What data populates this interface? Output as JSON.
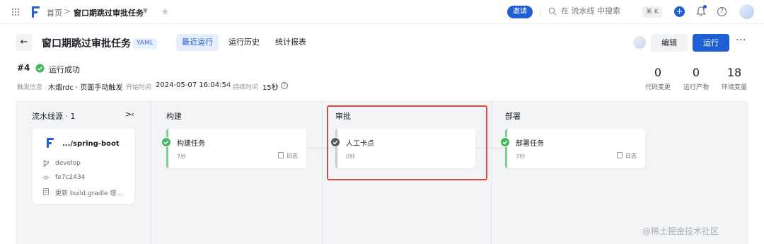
{
  "topbar": {
    "breadcrumb_home": "首页",
    "breadcrumb_sep": ">",
    "breadcrumb_current": "窗口期跳过审批任务",
    "invite_label": "邀请",
    "search_placeholder": "在 流水线 中搜索",
    "shortcut": "⌘ K"
  },
  "header": {
    "title": "窗口期跳过审批任务",
    "badge": "YAML",
    "tabs": [
      "最近运行",
      "运行历史",
      "统计报表"
    ],
    "edit_label": "编辑",
    "run_label": "运行",
    "more_label": "···"
  },
  "run": {
    "number": "#4",
    "status": "运行成功",
    "trigger_label": "触发信息",
    "trigger_value": "木烟rdc · 页面手动触发",
    "start_label": "开始时间",
    "start_value": "2024-05-07 16:04:54",
    "duration_label": "持续时间",
    "duration_value": "15秒",
    "stats": [
      {
        "value": "0",
        "label": "代码变更"
      },
      {
        "value": "0",
        "label": "运行产物"
      },
      {
        "value": "18",
        "label": "环境变量"
      }
    ]
  },
  "source": {
    "title": "流水线源 · 1",
    "collapse": ">‹",
    "repo": ".../spring-boot",
    "branch": "develop",
    "commit": "fe7c2434",
    "message": "更新 build.gradle 增..."
  },
  "stages": [
    {
      "title": "构建",
      "job": "构建任务",
      "duration": "7秒",
      "log": "日志",
      "status": "success"
    },
    {
      "title": "审批",
      "job": "人工卡点",
      "duration": "0秒",
      "log": "",
      "status": "skipped"
    },
    {
      "title": "部署",
      "job": "部署任务",
      "duration": "7秒",
      "log": "日志",
      "status": "success"
    }
  ],
  "watermark": "@稀土掘金技术社区",
  "colors": {
    "primary": "#1f5fd6",
    "success": "#3fb95b",
    "highlight": "#e3463e"
  }
}
